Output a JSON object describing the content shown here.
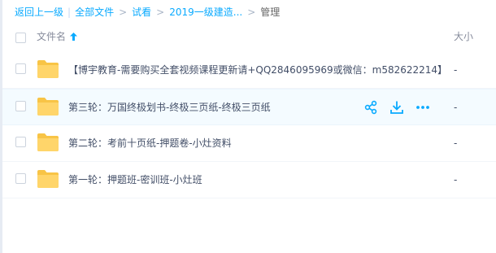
{
  "breadcrumb": {
    "back": "返回上一级",
    "all_files": "全部文件",
    "items": [
      "试看",
      "2019一级建造...",
      "管理"
    ]
  },
  "header": {
    "name_label": "文件名",
    "size_label": "大小",
    "sort": "ascending"
  },
  "files": [
    {
      "name": "【博宇教育-需要购买全套视频课程更新请+QQ2846095969或微信：m582622214】",
      "size": "-",
      "type": "folder"
    },
    {
      "name": "第三轮：万国终极划书-终极三页纸-终极三页纸",
      "size": "-",
      "type": "folder"
    },
    {
      "name": "第二轮：考前十页纸-押题卷-小灶资料",
      "size": "-",
      "type": "folder"
    },
    {
      "name": "第一轮：押题班-密训班-小灶班",
      "size": "-",
      "type": "folder"
    }
  ],
  "hovered_row_actions": [
    "share-icon",
    "download-icon",
    "more-icon"
  ],
  "colors": {
    "accent": "#09aaff",
    "folder": "#ffd56a",
    "hover_row": "#f4fbff"
  }
}
